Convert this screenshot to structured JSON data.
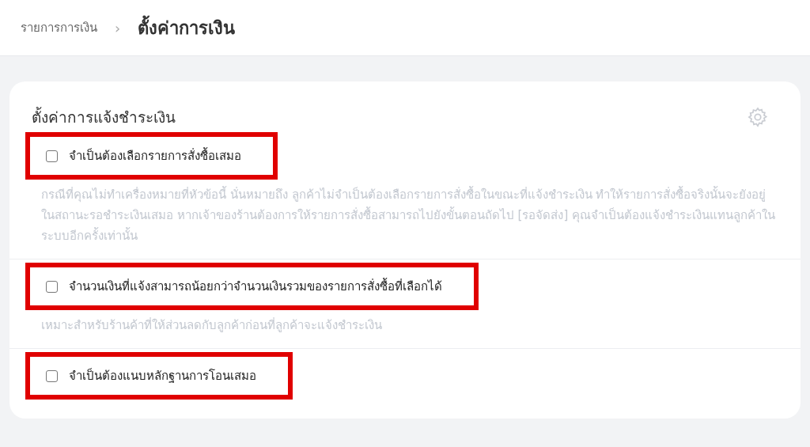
{
  "breadcrumb": {
    "parent": "รายการการเงิน",
    "separator": "›",
    "current": "ตั้งค่าการเงิน"
  },
  "card": {
    "title": "ตั้งค่าการแจ้งชำระเงิน",
    "options": [
      {
        "label": "จำเป็นต้องเลือกรายการสั่งซื้อเสมอ",
        "checked": false,
        "highlighted": true,
        "description": "กรณีที่คุณไม่ทำเครื่องหมายที่หัวข้อนี้ นั่นหมายถึง ลูกค้าไม่จำเป็นต้องเลือกรายการสั่งซื้อในขณะที่แจ้งชำระเงิน ทำให้รายการสั่งซื้อจริงนั้นจะยังอยู่ในสถานะรอชำระเงินเสมอ หากเจ้าของร้านต้องการให้รายการสั่งซื้อสามารถไปยังขั้นตอนถัดไป [รอจัดส่ง] คุณจำเป็นต้องแจ้งชำระเงินแทนลูกค้าในระบบอีกครั้งเท่านั้น"
      },
      {
        "label": "จำนวนเงินที่แจ้งสามารถน้อยกว่าจำนวนเงินรวมของรายการสั่งซื้อที่เลือกได้",
        "checked": false,
        "highlighted": true,
        "description": "เหมาะสำหรับร้านค้าที่ให้ส่วนลดกับลูกค้าก่อนที่ลูกค้าจะแจ้งชำระเงิน"
      },
      {
        "label": "จำเป็นต้องแนบหลักฐานการโอนเสมอ",
        "checked": false,
        "highlighted": true
      }
    ]
  }
}
